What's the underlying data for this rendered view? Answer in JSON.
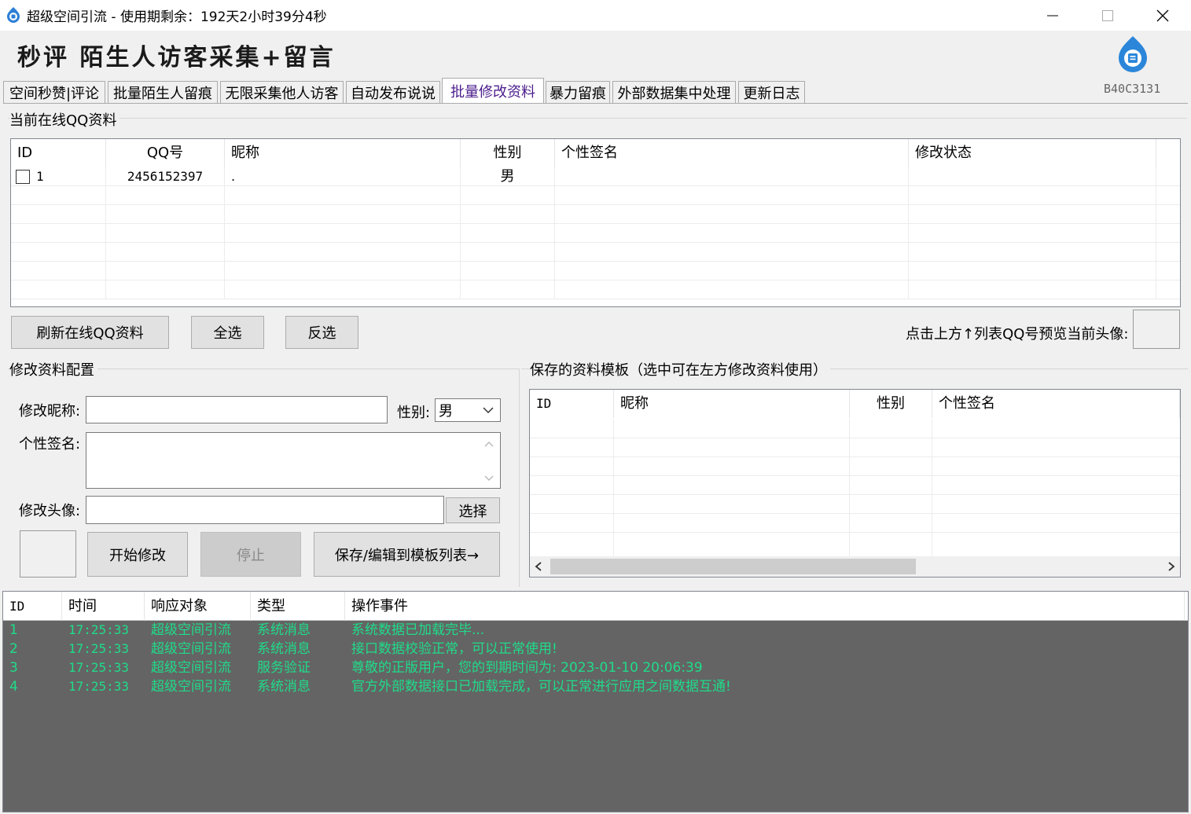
{
  "window": {
    "title": "超级空间引流 - 使用期剩余：192天2小时39分4秒",
    "minimize": "—",
    "maximize": "☐",
    "close": "✕"
  },
  "header": {
    "banner": "秒评 陌生人访客采集+留言",
    "version": "B40C3131"
  },
  "tabs": [
    {
      "label": "空间秒赞|评论"
    },
    {
      "label": "批量陌生人留痕"
    },
    {
      "label": "无限采集他人访客"
    },
    {
      "label": "自动发布说说"
    },
    {
      "label": "批量修改资料",
      "active": true
    },
    {
      "label": "暴力留痕"
    },
    {
      "label": "外部数据集中处理"
    },
    {
      "label": "更新日志"
    }
  ],
  "online": {
    "group_title": "当前在线QQ资料",
    "columns": [
      "ID",
      "QQ号",
      "昵称",
      "性别",
      "个性签名",
      "修改状态"
    ],
    "rows": [
      {
        "id": "1",
        "qq": "2456152397",
        "nickname": ".",
        "gender": "男",
        "signature": "",
        "status": ""
      }
    ],
    "refresh_button": "刷新在线QQ资料",
    "select_all_button": "全选",
    "invert_button": "反选",
    "preview_label": "点击上方↑列表QQ号预览当前头像:"
  },
  "config": {
    "group_title": "修改资料配置",
    "nickname_label": "修改昵称:",
    "nickname_value": "",
    "gender_label": "性别:",
    "gender_value": "男",
    "signature_label": "个性签名:",
    "signature_value": "",
    "avatar_label": "修改头像:",
    "avatar_value": "",
    "choose_button": "选择",
    "start_button": "开始修改",
    "stop_button": "停止",
    "save_button": "保存/编辑到模板列表→"
  },
  "templates": {
    "group_title": "保存的资料模板（选中可在左方修改资料使用）",
    "columns": [
      "ID",
      "昵称",
      "性别",
      "个性签名"
    ],
    "rows": []
  },
  "log": {
    "columns": [
      "ID",
      "时间",
      "响应对象",
      "类型",
      "操作事件"
    ],
    "text_color": "#1fdc8a",
    "rows": [
      {
        "id": "1",
        "time": "17:25:33",
        "target": "超级空间引流",
        "type": "系统消息",
        "event": "系统数据已加载完毕..."
      },
      {
        "id": "2",
        "time": "17:25:33",
        "target": "超级空间引流",
        "type": "系统消息",
        "event": "接口数据校验正常，可以正常使用!"
      },
      {
        "id": "3",
        "time": "17:25:33",
        "target": "超级空间引流",
        "type": "服务验证",
        "event": "尊敬的正版用户，您的到期时间为: 2023-01-10 20:06:39"
      },
      {
        "id": "4",
        "time": "17:25:33",
        "target": "超级空间引流",
        "type": "系统消息",
        "event": "官方外部数据接口已加载完成，可以正常进行应用之间数据互通!"
      }
    ]
  }
}
